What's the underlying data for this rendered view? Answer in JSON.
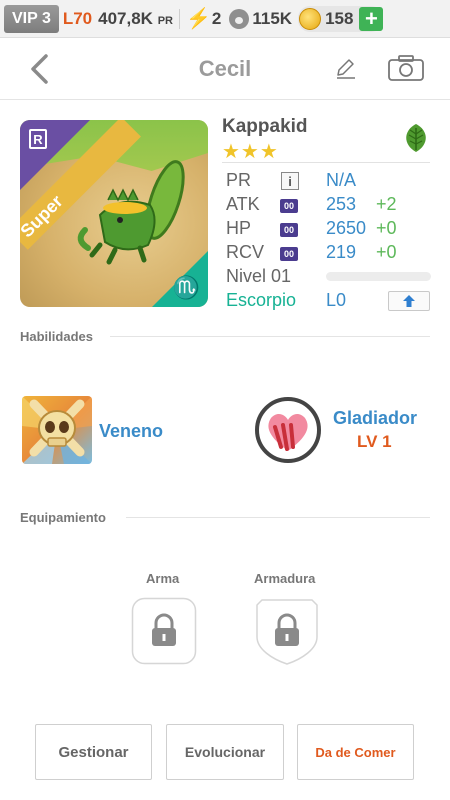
{
  "status_bar": {
    "vip": "VIP 3",
    "level": "L70",
    "power": "407,8K",
    "power_unit": "PR",
    "energy": "2",
    "food": "115K",
    "coins": "158",
    "add_button": "+"
  },
  "header": {
    "title": "Cecil"
  },
  "monster": {
    "rarity_badge": "R",
    "tier_ribbon": "Super",
    "zodiac_glyph": "♏",
    "name": "Kappakid",
    "stars": "★★★",
    "element": "leaf-icon"
  },
  "stats": {
    "pr": {
      "label": "PR",
      "icon": "i",
      "value": "N/A"
    },
    "atk": {
      "label": "ATK",
      "tag": "00",
      "value": "253",
      "bonus": "+2"
    },
    "hp": {
      "label": "HP",
      "tag": "00",
      "value": "2650",
      "bonus": "+0"
    },
    "rcv": {
      "label": "RCV",
      "tag": "00",
      "value": "219",
      "bonus": "+0"
    },
    "level": {
      "label": "Nivel 01",
      "progress": 0.0
    },
    "sign": {
      "label": "Escorpio",
      "value": "L0"
    }
  },
  "sections": {
    "abilities": "Habilidades",
    "equipment": "Equipamiento"
  },
  "skills": [
    {
      "name": "Veneno"
    },
    {
      "name": "Gladiador",
      "level": "LV 1"
    }
  ],
  "equipment": {
    "weapon": "Arma",
    "armor": "Armadura"
  },
  "buttons": {
    "manage": "Gestionar",
    "evolve": "Evolucionar",
    "feed": "Da de Comer"
  },
  "colors": {
    "accent_blue": "#3a8bc8",
    "accent_orange": "#e05a1e",
    "accent_green": "#5db85a",
    "zodiac_teal": "#17b294"
  }
}
